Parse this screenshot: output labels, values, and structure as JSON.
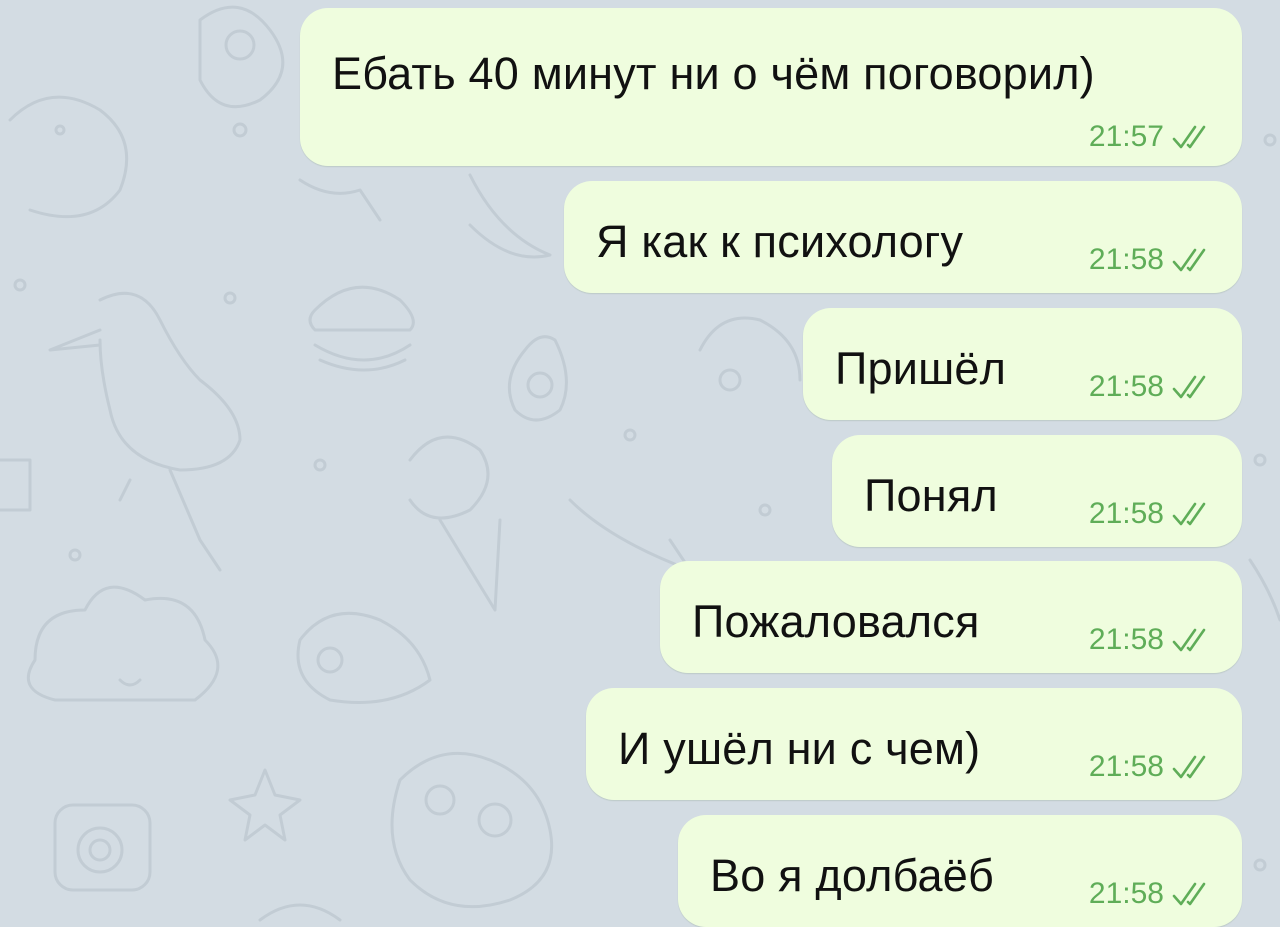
{
  "theme": {
    "background": "#d3dce3",
    "bubble": "#effdde",
    "time_color": "#5fad58",
    "text_color": "#111111"
  },
  "messages": [
    {
      "text": "Ебать 40 минут ни о чём поговорил)",
      "time": "21:57",
      "status": "read-double-check"
    },
    {
      "text": "Я как к психологу",
      "time": "21:58",
      "status": "read-double-check"
    },
    {
      "text": "Пришёл",
      "time": "21:58",
      "status": "read-double-check"
    },
    {
      "text": "Понял",
      "time": "21:58",
      "status": "read-double-check"
    },
    {
      "text": "Пожаловался",
      "time": "21:58",
      "status": "read-double-check"
    },
    {
      "text": "И ушёл ни с чем)",
      "time": "21:58",
      "status": "read-double-check"
    },
    {
      "text": "Во я долбаёб",
      "time": "21:58",
      "status": "read-double-check"
    }
  ]
}
